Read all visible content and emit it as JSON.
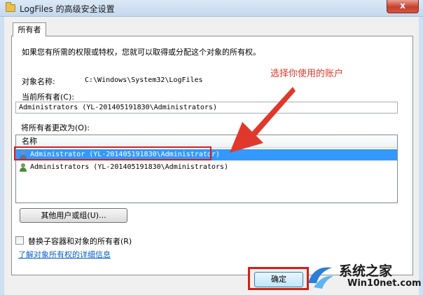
{
  "window": {
    "title": "LogFiles 的高级安全设置",
    "close_label": "x"
  },
  "tab": {
    "label": "所有者"
  },
  "panel": {
    "intro": "如果您有所需的权限或特权，您就可以取得或分配这个对象的所有权。",
    "object_name_label": "对象名称:",
    "object_name_value": "C:\\Windows\\System32\\LogFiles",
    "current_owner_label": "当前所有者(C):",
    "current_owner_value": "Administrators (YL-201405191830\\Administrators)",
    "change_owner_label": "将所有者更改为(O):",
    "list": {
      "column_name": "名称",
      "rows": [
        {
          "name": "Administrator (YL-201405191830\\Administrator)",
          "selected": true,
          "icon": "user-icon"
        },
        {
          "name": "Administrators (YL-201405191830\\Administrators)",
          "selected": false,
          "icon": "group-icon"
        }
      ]
    },
    "other_users_button": "其他用户或组(U)...",
    "replace_owner_checkbox": {
      "label": "替换子容器和对象的所有者(R)",
      "checked": false
    },
    "learn_more_link": "了解对象所有权的详细信息"
  },
  "annotation": {
    "text": "选择你使用的账户",
    "color": "#e0392b"
  },
  "footer": {
    "ok_button": "确定"
  },
  "watermark": {
    "title": "系统之家",
    "url": "Win10net.com"
  },
  "colors": {
    "selection": "#3399ff",
    "highlight_red": "#d2201b",
    "link": "#0b5fc6"
  }
}
